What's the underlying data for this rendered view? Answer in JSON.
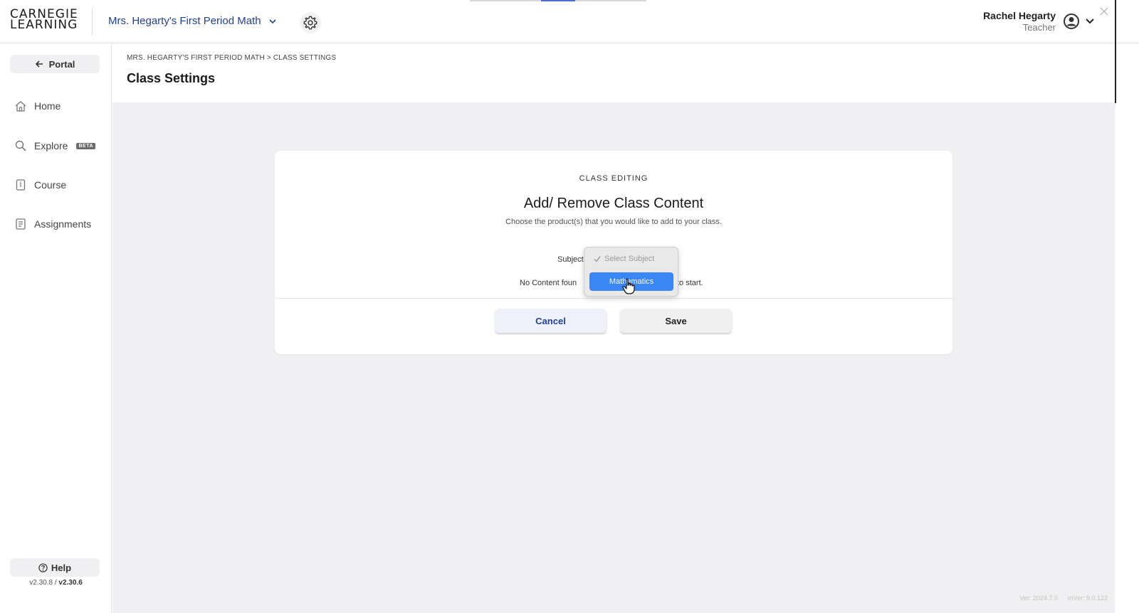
{
  "header": {
    "logo_line1": "CARNEGIE",
    "logo_line2": "LEARNING",
    "class_name": "Mrs. Hegarty's First Period Math",
    "user_name": "Rachel Hegarty",
    "user_role": "Teacher"
  },
  "sidebar": {
    "portal_label": "Portal",
    "items": [
      {
        "label": "Home",
        "icon": "home-icon"
      },
      {
        "label": "Explore",
        "icon": "search-icon",
        "badge": "BETA"
      },
      {
        "label": "Course",
        "icon": "course-icon"
      },
      {
        "label": "Assignments",
        "icon": "assignments-icon"
      }
    ],
    "help_label": "Help",
    "version_a": "v2.30.8",
    "version_sep": " / ",
    "version_b": "v2.30.6"
  },
  "page": {
    "breadcrumb": "MRS. HEGARTY'S FIRST PERIOD MATH > CLASS SETTINGS",
    "title": "Class Settings"
  },
  "card": {
    "kicker": "CLASS EDITING",
    "title": "Add/ Remove Class Content",
    "subtitle": "Choose the product(s) that you would like to add to your class.",
    "subject_label": "Subject",
    "no_content_text": "No Content foun",
    "no_content_tail": "to start.",
    "cancel_label": "Cancel",
    "save_label": "Save"
  },
  "dropdown": {
    "placeholder": "Select Subject",
    "options": [
      "Mathematics"
    ],
    "highlighted": "Mathematics"
  },
  "footer": {
    "ver": "Ver: 2024.7.0",
    "mver": "mVer: 9.0.122"
  },
  "colors": {
    "brand_blue": "#21409a",
    "highlight_blue": "#3a86f5",
    "background_gray": "#f0f0f2"
  }
}
